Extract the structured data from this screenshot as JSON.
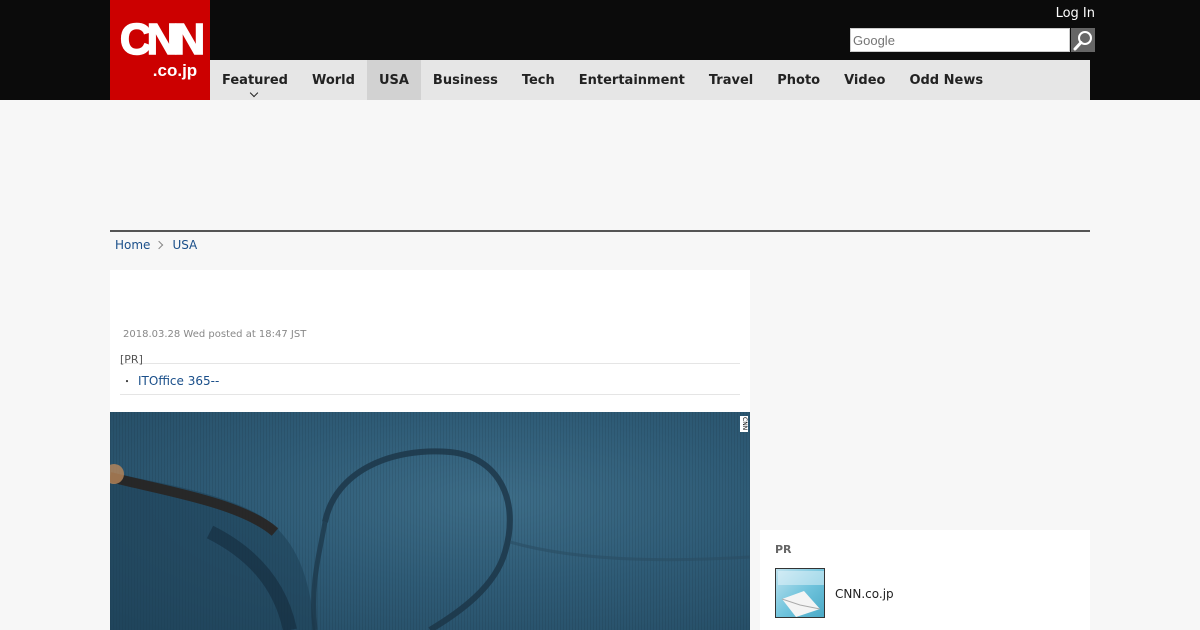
{
  "header": {
    "logo_main": "CNN",
    "logo_sub": ".co.jp",
    "login": "Log In",
    "search_placeholder": "Google"
  },
  "nav": {
    "items": [
      {
        "label": "Featured",
        "dropdown": true
      },
      {
        "label": "World"
      },
      {
        "label": "USA",
        "active": true
      },
      {
        "label": "Business"
      },
      {
        "label": "Tech"
      },
      {
        "label": "Entertainment"
      },
      {
        "label": "Travel"
      },
      {
        "label": "Photo"
      },
      {
        "label": "Video"
      },
      {
        "label": "Odd News"
      }
    ]
  },
  "breadcrumb": {
    "home": "Home",
    "current": "USA"
  },
  "article": {
    "posted": "2018.03.28 Wed posted at 18:47 JST",
    "pr_label": "[PR]",
    "pr_link": "ITOffice 365--",
    "photo_watermark": "CNN"
  },
  "sidebar": {
    "pr_label": "PR",
    "pr_item": "CNN.co.jp"
  },
  "colors": {
    "brand_red": "#cc0000",
    "topbar": "#0b0b0b",
    "link": "#1a4f8a"
  }
}
